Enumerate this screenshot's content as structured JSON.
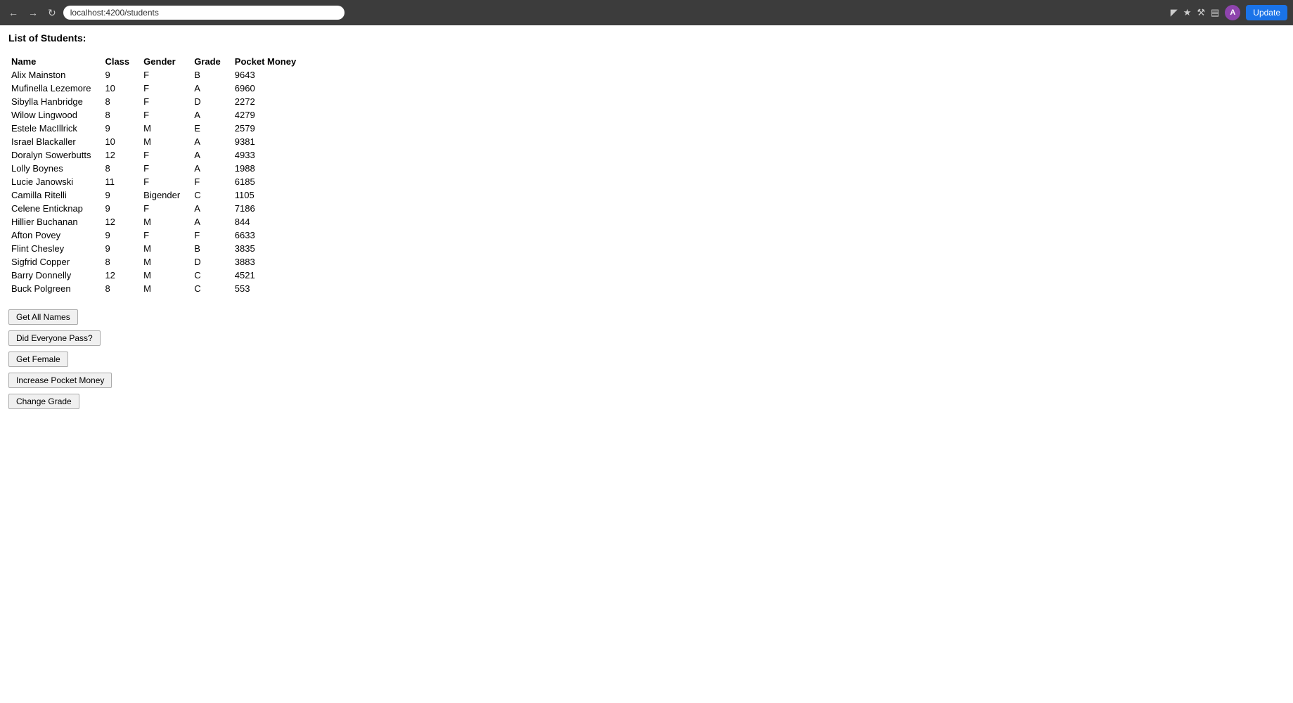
{
  "browser": {
    "url": "localhost:4200/students",
    "update_label": "Update"
  },
  "page": {
    "title": "List of Students:"
  },
  "table": {
    "headers": [
      "Name",
      "Class",
      "Gender",
      "Grade",
      "Pocket Money"
    ],
    "rows": [
      {
        "name": "Alix Mainston",
        "class": "9",
        "gender": "F",
        "grade": "B",
        "pocket_money": "9643"
      },
      {
        "name": "Mufinella Lezemore",
        "class": "10",
        "gender": "F",
        "grade": "A",
        "pocket_money": "6960"
      },
      {
        "name": "Sibylla Hanbridge",
        "class": "8",
        "gender": "F",
        "grade": "D",
        "pocket_money": "2272"
      },
      {
        "name": "Wilow Lingwood",
        "class": "8",
        "gender": "F",
        "grade": "A",
        "pocket_money": "4279"
      },
      {
        "name": "Estele MacIllrick",
        "class": "9",
        "gender": "M",
        "grade": "E",
        "pocket_money": "2579"
      },
      {
        "name": "Israel Blackaller",
        "class": "10",
        "gender": "M",
        "grade": "A",
        "pocket_money": "9381"
      },
      {
        "name": "Doralyn Sowerbutts",
        "class": "12",
        "gender": "F",
        "grade": "A",
        "pocket_money": "4933"
      },
      {
        "name": "Lolly Boynes",
        "class": "8",
        "gender": "F",
        "grade": "A",
        "pocket_money": "1988"
      },
      {
        "name": "Lucie Janowski",
        "class": "11",
        "gender": "F",
        "grade": "F",
        "pocket_money": "6185"
      },
      {
        "name": "Camilla Ritelli",
        "class": "9",
        "gender": "Bigender",
        "grade": "C",
        "pocket_money": "1105"
      },
      {
        "name": "Celene Enticknap",
        "class": "9",
        "gender": "F",
        "grade": "A",
        "pocket_money": "7186"
      },
      {
        "name": "Hillier Buchanan",
        "class": "12",
        "gender": "M",
        "grade": "A",
        "pocket_money": "844"
      },
      {
        "name": "Afton Povey",
        "class": "9",
        "gender": "F",
        "grade": "F",
        "pocket_money": "6633"
      },
      {
        "name": "Flint Chesley",
        "class": "9",
        "gender": "M",
        "grade": "B",
        "pocket_money": "3835"
      },
      {
        "name": "Sigfrid Copper",
        "class": "8",
        "gender": "M",
        "grade": "D",
        "pocket_money": "3883"
      },
      {
        "name": "Barry Donnelly",
        "class": "12",
        "gender": "M",
        "grade": "C",
        "pocket_money": "4521"
      },
      {
        "name": "Buck Polgreen",
        "class": "8",
        "gender": "M",
        "grade": "C",
        "pocket_money": "553"
      }
    ]
  },
  "buttons": {
    "get_all_names": "Get All Names",
    "did_everyone_pass": "Did Everyone Pass?",
    "get_female": "Get Female",
    "increase_pocket_money": "Increase Pocket Money",
    "change_grade": "Change Grade"
  }
}
